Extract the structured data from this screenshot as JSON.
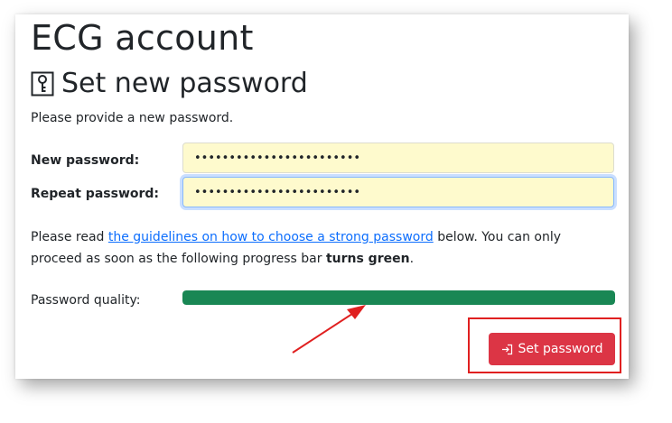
{
  "page": {
    "title": "ECG account",
    "subtitle": "Set new password",
    "intro": "Please provide a new password."
  },
  "form": {
    "new_password_label": "New password:",
    "new_password_value": "••••••••••••••••••••••••",
    "repeat_password_label": "Repeat password:",
    "repeat_password_value": "••••••••••••••••••••••••"
  },
  "guidelines": {
    "text_before": "Please read ",
    "link_text": "the guidelines on how to choose a strong password",
    "text_middle": " below. You can only proceed as soon as the following progress bar ",
    "emphasis": "turns green",
    "text_after": "."
  },
  "quality": {
    "label": "Password quality:",
    "fraction": 1.0,
    "color": "#198754"
  },
  "button": {
    "label": "Set password",
    "icon": "sign-in-icon",
    "color": "#dc3545"
  },
  "annotation": {
    "color": "#e02020"
  }
}
